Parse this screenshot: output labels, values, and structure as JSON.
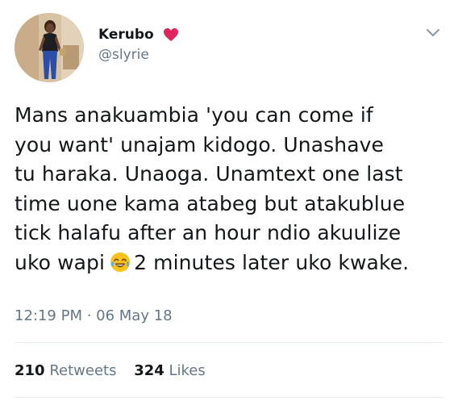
{
  "user": {
    "display_name": "Kerubo",
    "handle": "@slyrie",
    "name_emoji": "heart-icon"
  },
  "tweet": {
    "text_part1": "Mans anakuambia 'you can come if\nyou want' unajam kidogo. Unashave\ntu haraka. Unaoga. Unamtext one last\ntime uone kama atabeg but atakublue\ntick halafu after an hour ndio akuulize\nuko wapi",
    "inline_emoji": "face-with-tears-of-joy-icon",
    "text_part2": "2 minutes later uko kwake.",
    "timestamp": "12:19 PM · 06 May 18"
  },
  "stats": {
    "retweets_count": "210",
    "retweets_label": "Retweets",
    "likes_count": "324",
    "likes_label": "Likes"
  },
  "colors": {
    "text": "#14171a",
    "secondary": "#657786",
    "divider": "#e6ecf0",
    "heart": "#e0245e"
  }
}
